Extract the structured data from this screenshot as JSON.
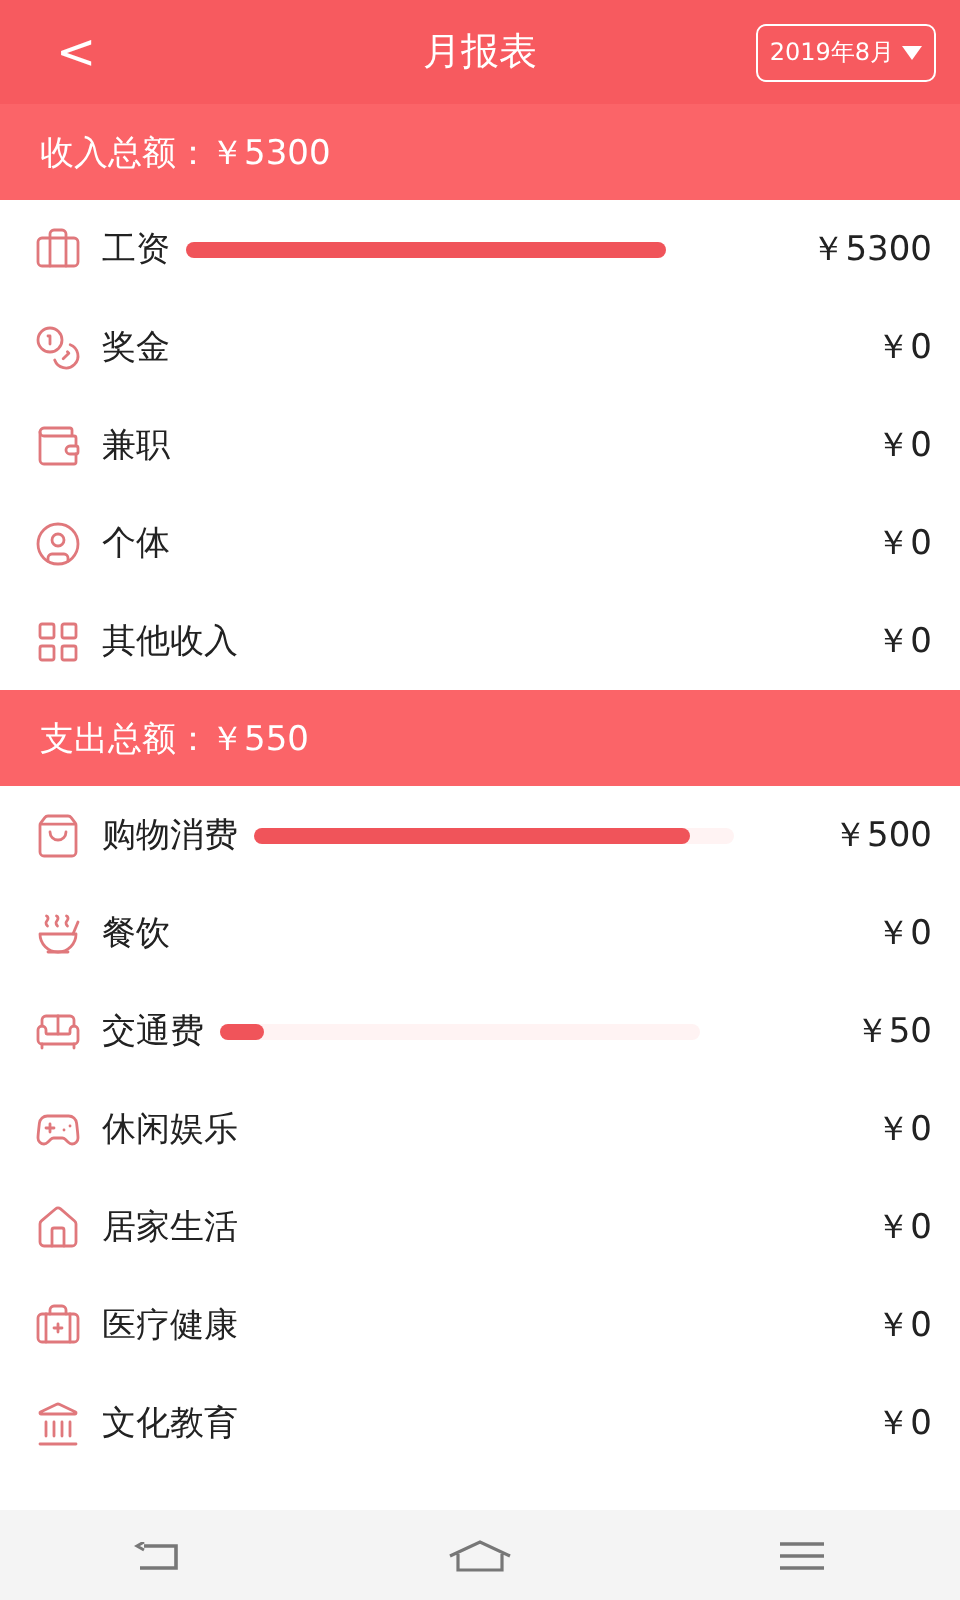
{
  "header": {
    "back": "<",
    "title": "月报表",
    "month": "2019年8月"
  },
  "sections": [
    {
      "title": "收入总额：￥5300",
      "items": [
        {
          "label": "工资",
          "level": 1,
          "amount": "￥5300"
        },
        {
          "label": "奖金",
          "amount": "￥0"
        },
        {
          "label": "兼职",
          "amount": "￥0"
        },
        {
          "label": "个体",
          "amount": "￥0"
        },
        {
          "label": "其他收入",
          "amount": "￥0"
        }
      ]
    },
    {
      "title": "支出总额：￥550",
      "items": [
        {
          "label": "购物消费",
          "level": 0.91,
          "amount": "￥500"
        },
        {
          "label": "餐饮",
          "amount": "￥0"
        },
        {
          "label": "交通费",
          "level": 0.09,
          "amount": "￥50"
        },
        {
          "label": "休闲娱乐",
          "amount": "￥0"
        },
        {
          "label": "居家生活",
          "amount": "￥0"
        },
        {
          "label": "医疗健康",
          "amount": "￥0"
        },
        {
          "label": "文化教育",
          "amount": "￥0"
        }
      ]
    }
  ]
}
